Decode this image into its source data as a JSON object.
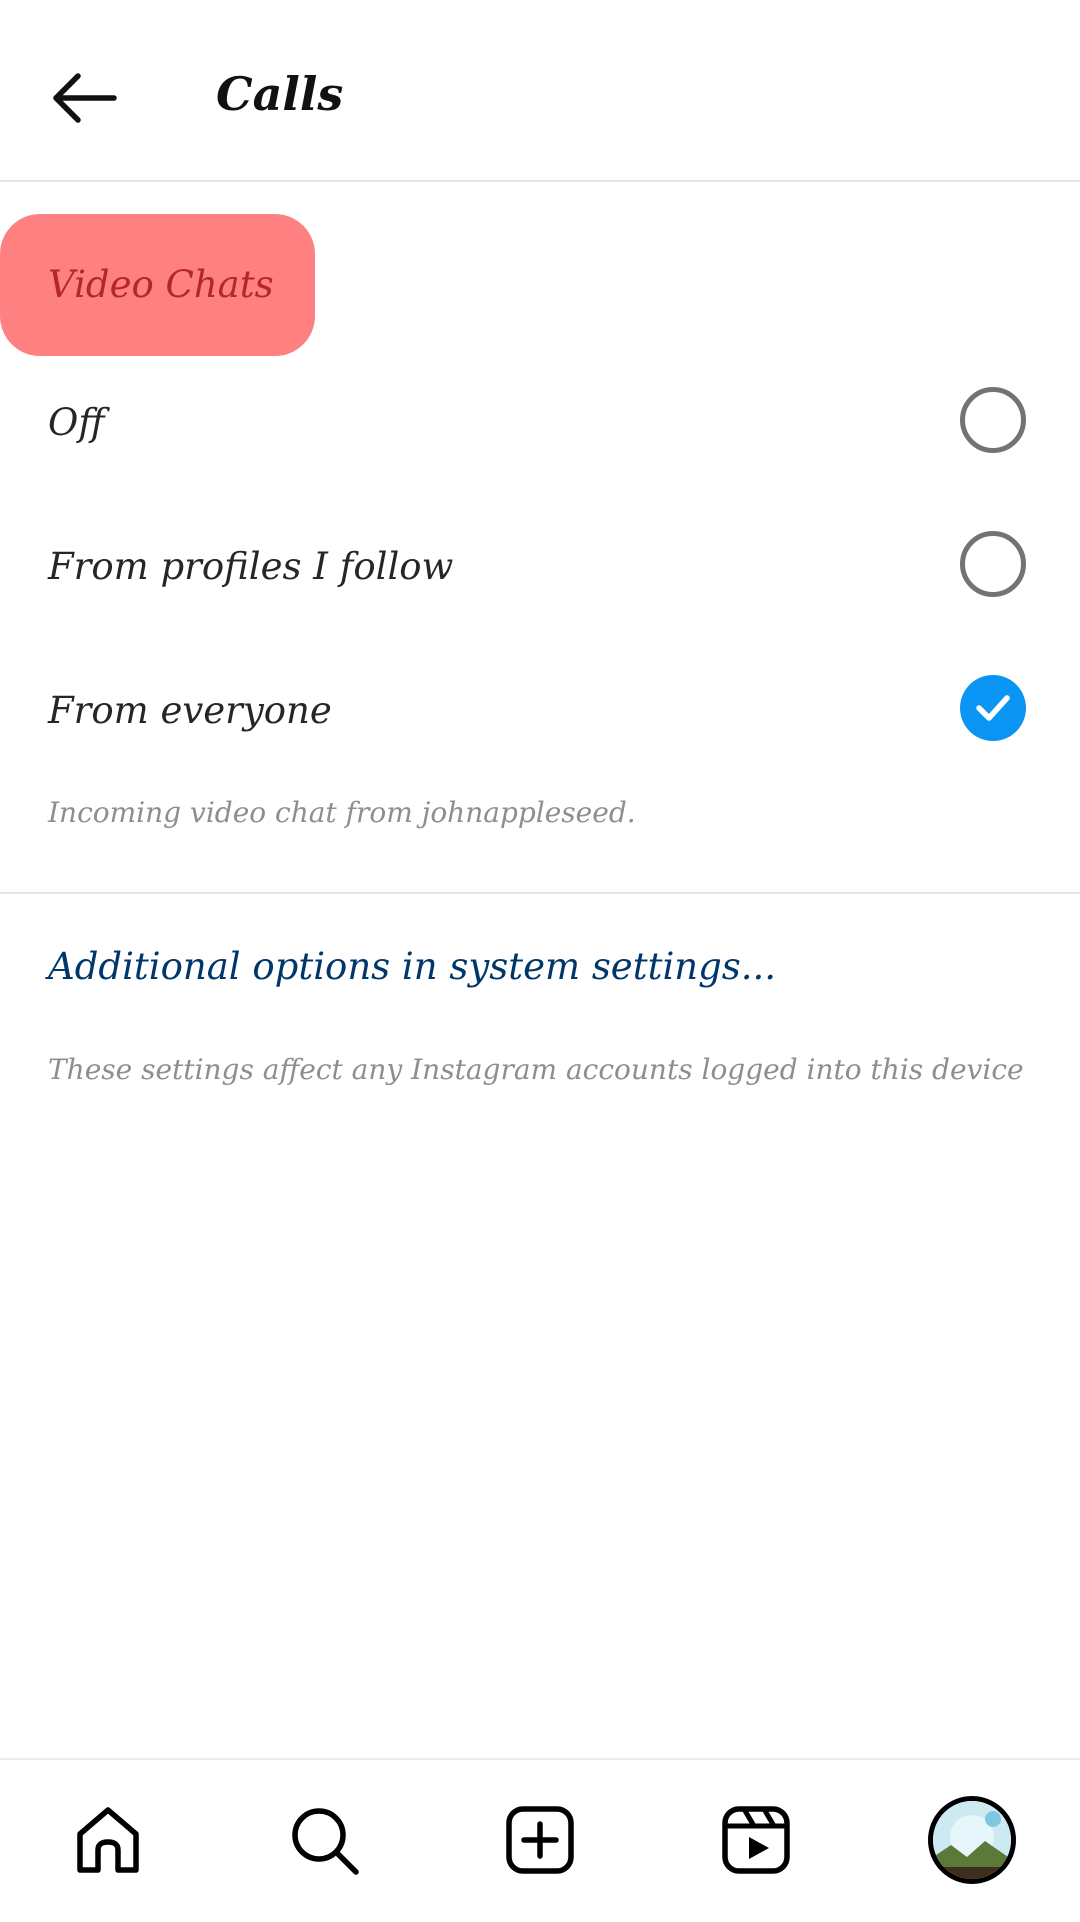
{
  "header": {
    "title": "Calls",
    "back_icon": "arrow-left-icon"
  },
  "section": {
    "label": "Video Chats",
    "highlight_color": "#ff8080"
  },
  "options": [
    {
      "label": "Off",
      "selected": false
    },
    {
      "label": "From profiles I follow",
      "selected": false
    },
    {
      "label": "From everyone",
      "selected": true
    }
  ],
  "helper_text": "Incoming video chat from johnappleseed.",
  "system_link": "Additional options in system settings...",
  "footer_note": "These settings affect any Instagram accounts logged into this device",
  "colors": {
    "accent": "#0a95f5",
    "link": "#00376b",
    "secondary_text": "#8e8e8e"
  },
  "bottom_nav": {
    "items": [
      "home-icon",
      "search-icon",
      "create-post-icon",
      "reels-icon",
      "profile-avatar"
    ]
  }
}
